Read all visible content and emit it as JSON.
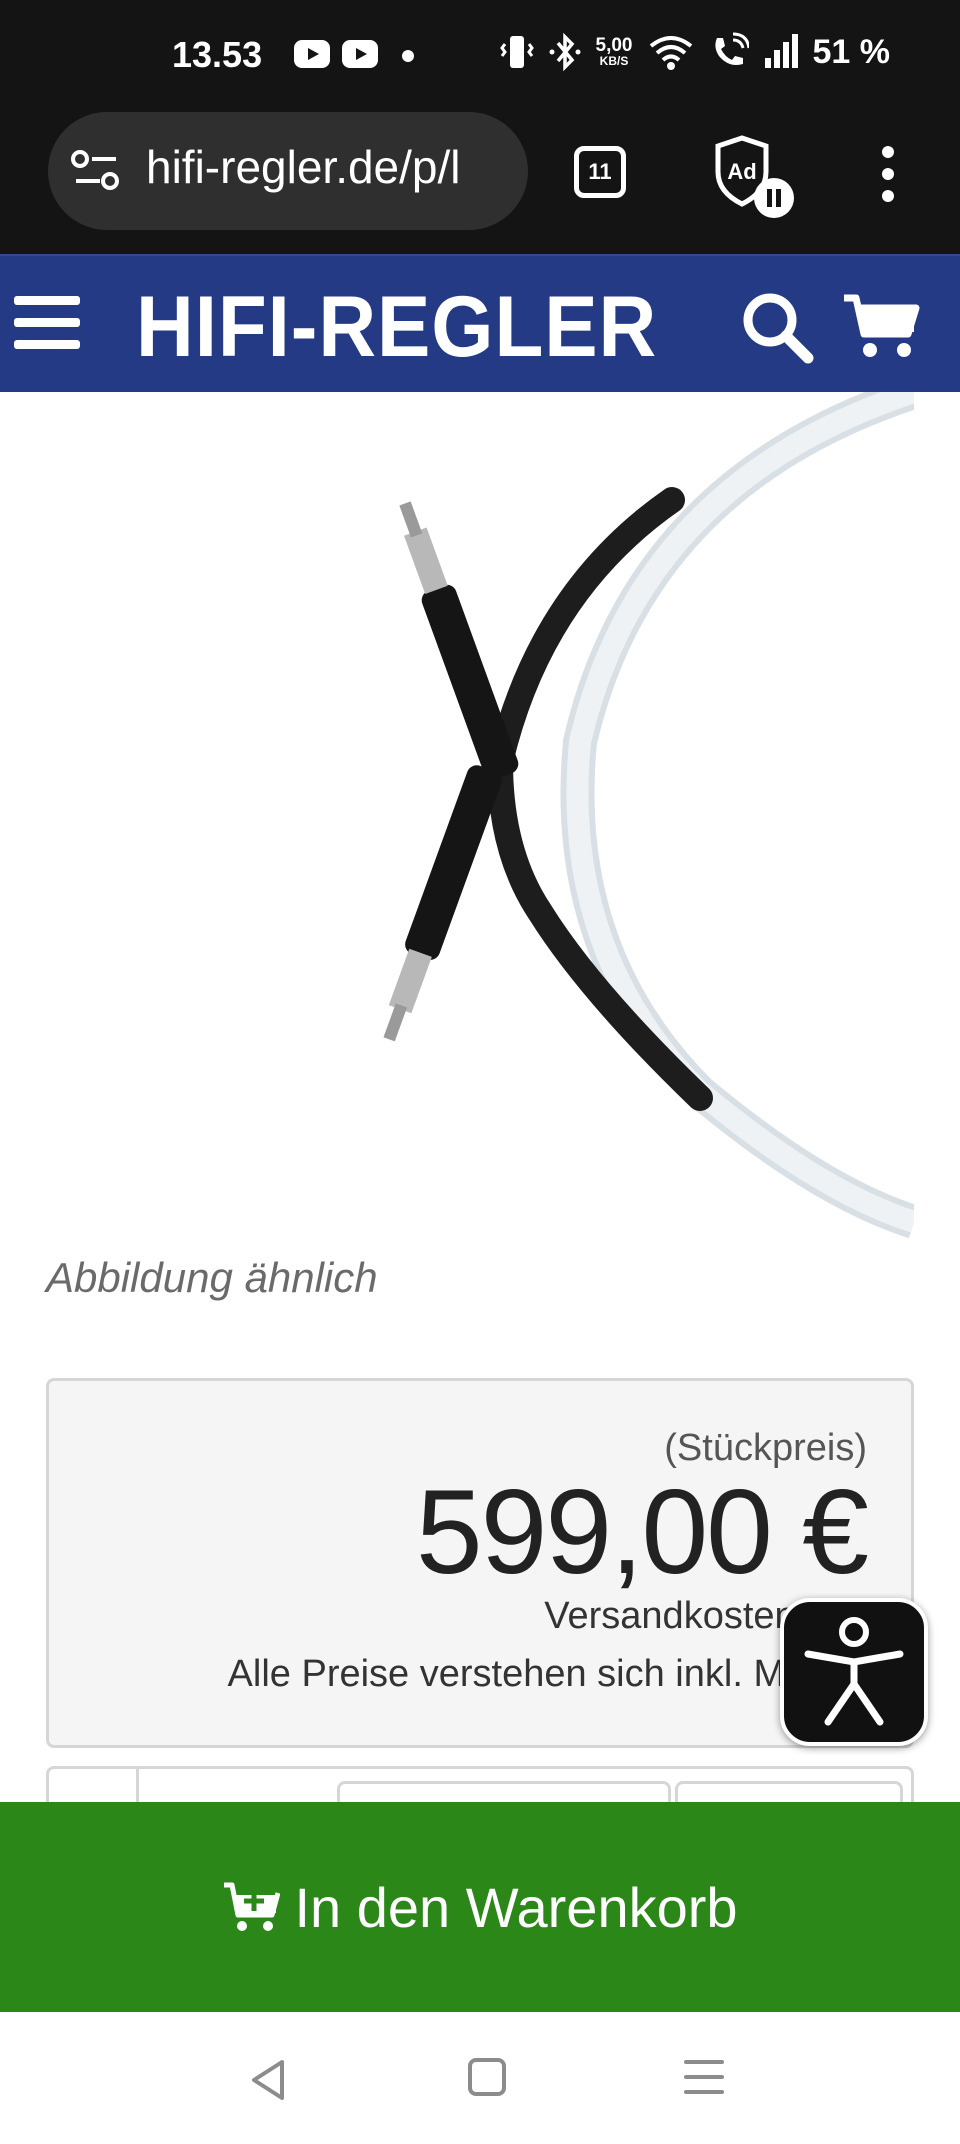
{
  "status_bar": {
    "time": "13.53",
    "net_speed": "5,00",
    "net_speed_unit": "KB/S",
    "battery": "51 %"
  },
  "browser": {
    "url": "hifi-regler.de/p/l",
    "tab_count": "11",
    "adblock_label": "Ad"
  },
  "site": {
    "logo": "HIFI-REGLER"
  },
  "product": {
    "image_caption": "Abbildung ähnlich",
    "unit_price_label": "(Stückpreis)",
    "price": "599,00 €",
    "shipping_text": "Versandkostenfrei!",
    "vat_text": "Alle Preise verstehen sich inkl. MwSt."
  },
  "cart": {
    "add_label": "In den Warenkorb"
  },
  "colors": {
    "header_bg": "#243a84",
    "cart_button_bg": "#2b8717",
    "system_bar_bg": "#141414"
  },
  "icons": [
    "youtube-icon",
    "vibrate-icon",
    "bluetooth-icon",
    "wifi-icon",
    "wifi-calling-icon",
    "signal-icon",
    "site-settings-icon",
    "tab-switcher-icon",
    "adblock-icon",
    "more-menu-icon",
    "hamburger-menu-icon",
    "search-icon",
    "cart-icon",
    "accessibility-icon",
    "cart-add-icon",
    "back-icon",
    "home-icon",
    "recents-icon"
  ]
}
